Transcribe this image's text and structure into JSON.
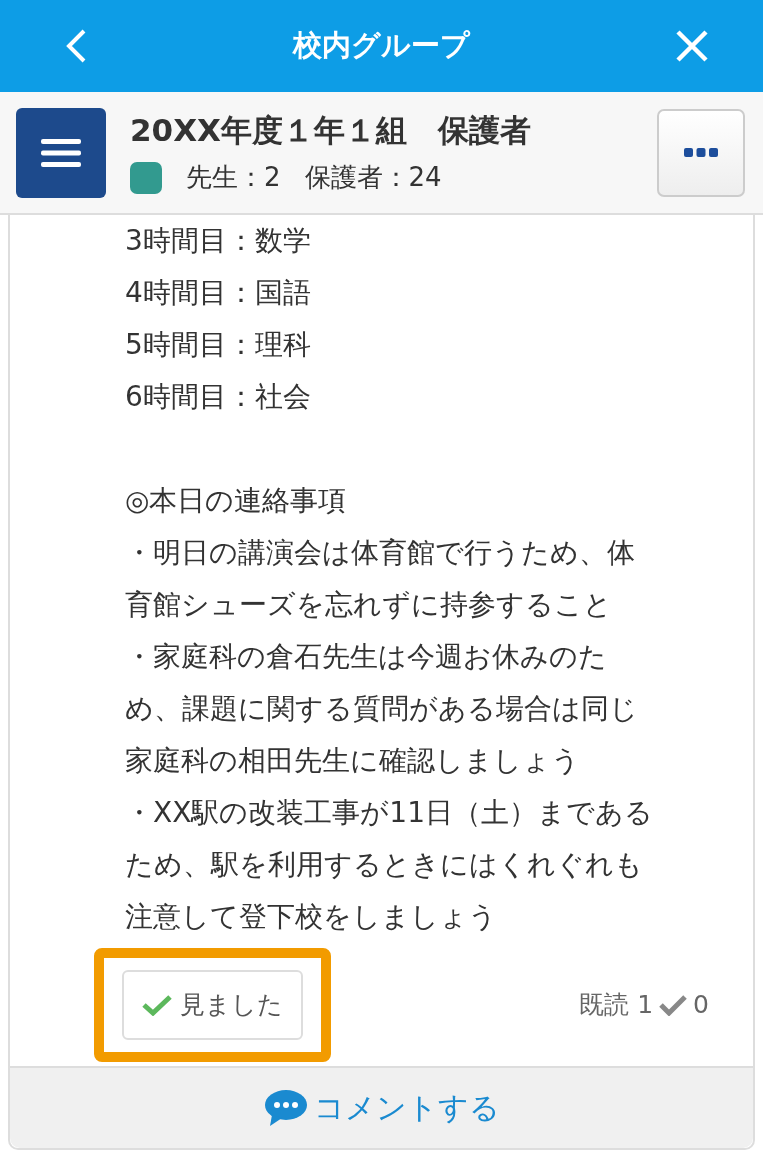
{
  "header": {
    "title": "校内グループ"
  },
  "group": {
    "name": "20XX年度１年１組　保護者",
    "color": "#329a8f",
    "teachers": "先生：2",
    "guardians": "保護者：24"
  },
  "post": {
    "blocks": [
      {
        "lines": [
          "3時間目：数学",
          "4時間目：国語",
          "5時間目：理科",
          "6時間目：社会"
        ]
      },
      {
        "lines": [
          "◎本日の連絡事項",
          "・明日の講演会は体育館で行うため、体",
          "育館シューズを忘れずに持参すること",
          "・家庭科の倉石先生は今週お休みのた",
          "め、課題に関する質問がある場合は同じ",
          "家庭科の相田先生に確認しましょう",
          "・XX駅の改装工事が11日（土）まである",
          "ため、駅を利用するときにはくれぐれも",
          "注意して登下校をしましょう"
        ]
      }
    ],
    "seen_button": {
      "label": "見ました",
      "highlighted": true
    },
    "read_label": "既読 1",
    "seen_count": "0",
    "comment_button": "コメントする"
  }
}
